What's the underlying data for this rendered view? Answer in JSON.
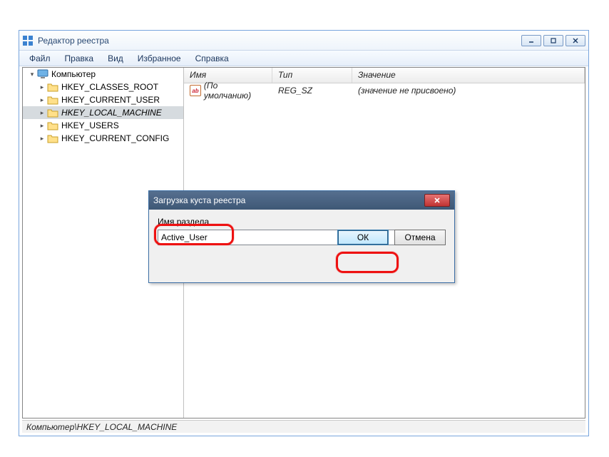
{
  "window": {
    "title": "Редактор реестра"
  },
  "menu": {
    "file": "Файл",
    "edit": "Правка",
    "view": "Вид",
    "favorites": "Избранное",
    "help": "Справка"
  },
  "tree": {
    "root": "Компьютер",
    "keys": [
      "HKEY_CLASSES_ROOT",
      "HKEY_CURRENT_USER",
      "HKEY_LOCAL_MACHINE",
      "HKEY_USERS",
      "HKEY_CURRENT_CONFIG"
    ],
    "selected_index": 2
  },
  "list": {
    "columns": {
      "name": "Имя",
      "type": "Тип",
      "value": "Значение"
    },
    "rows": [
      {
        "icon": "string-value-icon",
        "name": "(По умолчанию)",
        "type": "REG_SZ",
        "value": "(значение не присвоено)"
      }
    ]
  },
  "dialog": {
    "title": "Загрузка куста реестра",
    "label": "Имя раздела",
    "input_value": "Active_User",
    "ok": "ОК",
    "cancel": "Отмена"
  },
  "statusbar": {
    "path": "Компьютер\\HKEY_LOCAL_MACHINE"
  },
  "icons": {
    "string_value_ab": "ab"
  }
}
